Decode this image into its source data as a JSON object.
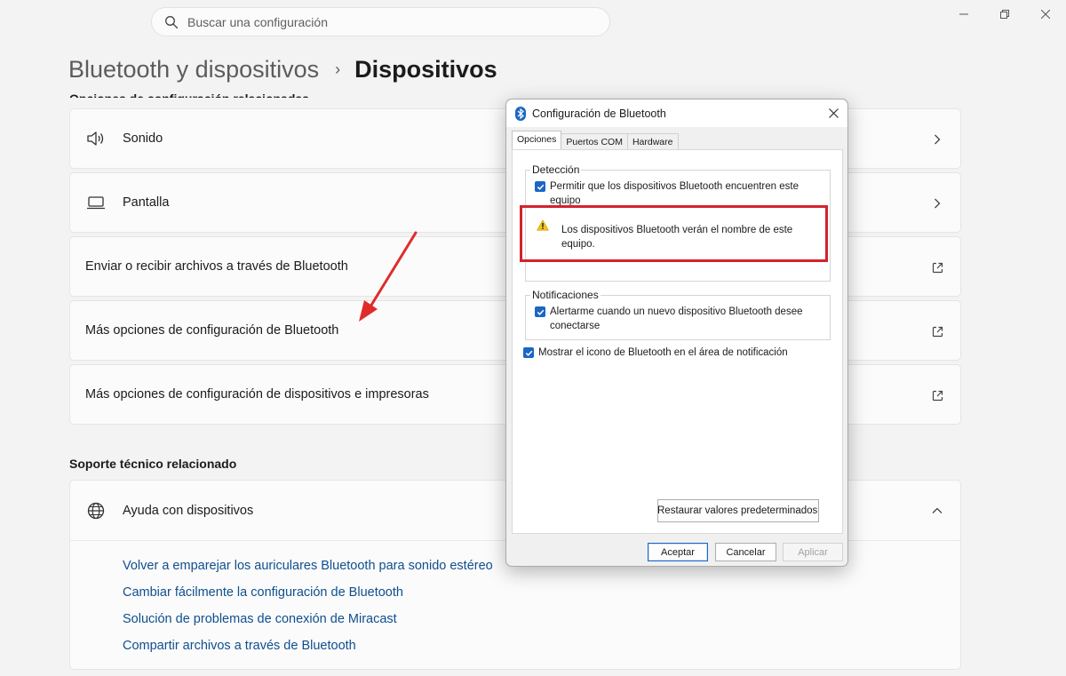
{
  "search": {
    "placeholder": "Buscar una configuración"
  },
  "breadcrumb": {
    "parent": "Bluetooth y dispositivos",
    "separator": "›",
    "current": "Dispositivos"
  },
  "related_settings_title": "Opciones de configuración relacionadas",
  "cards": [
    {
      "label": "Sonido",
      "icon": "speaker-icon",
      "trail": "chevron-right-icon"
    },
    {
      "label": "Pantalla",
      "icon": "monitor-icon",
      "trail": "chevron-right-icon"
    },
    {
      "label": "Enviar o recibir archivos a través de Bluetooth",
      "trail": "external-link-icon"
    },
    {
      "label": "Más opciones de configuración de Bluetooth",
      "trail": "external-link-icon"
    },
    {
      "label": "Más opciones de configuración de dispositivos e impresoras",
      "trail": "external-link-icon"
    }
  ],
  "support": {
    "title": "Soporte técnico relacionado",
    "header": "Ayuda con dispositivos",
    "links": [
      "Volver a emparejar los auriculares Bluetooth para sonido estéreo",
      "Cambiar fácilmente la configuración de Bluetooth",
      "Solución de problemas de conexión de Miracast",
      "Compartir archivos a través de Bluetooth"
    ]
  },
  "dialog": {
    "title": "Configuración de Bluetooth",
    "tabs": [
      "Opciones",
      "Puertos COM",
      "Hardware"
    ],
    "active_tab": "Opciones",
    "detection": {
      "legend": "Detección",
      "checkbox_line1": "Permitir que los dispositivos Bluetooth encuentren este",
      "checkbox_line2": "equipo",
      "checked": true,
      "warning_line1": "Los dispositivos Bluetooth verán el nombre de este",
      "warning_line2": "equipo."
    },
    "notifications": {
      "legend": "Notificaciones",
      "checkbox_line1": "Alertarme cuando un nuevo dispositivo Bluetooth desee",
      "checkbox_line2": "conectarse",
      "checked": true
    },
    "tray_checkbox": {
      "label": "Mostrar el icono de Bluetooth en el área de notificación",
      "checked": true
    },
    "restore_button": "Restaurar valores predeterminados",
    "ok_button": "Aceptar",
    "cancel_button": "Cancelar",
    "apply_button": "Aplicar"
  },
  "colors": {
    "accent": "#1a67c4",
    "highlight": "#d3232e",
    "link": "#0f4f8f",
    "annotation_arrow": "#e02b2b"
  }
}
